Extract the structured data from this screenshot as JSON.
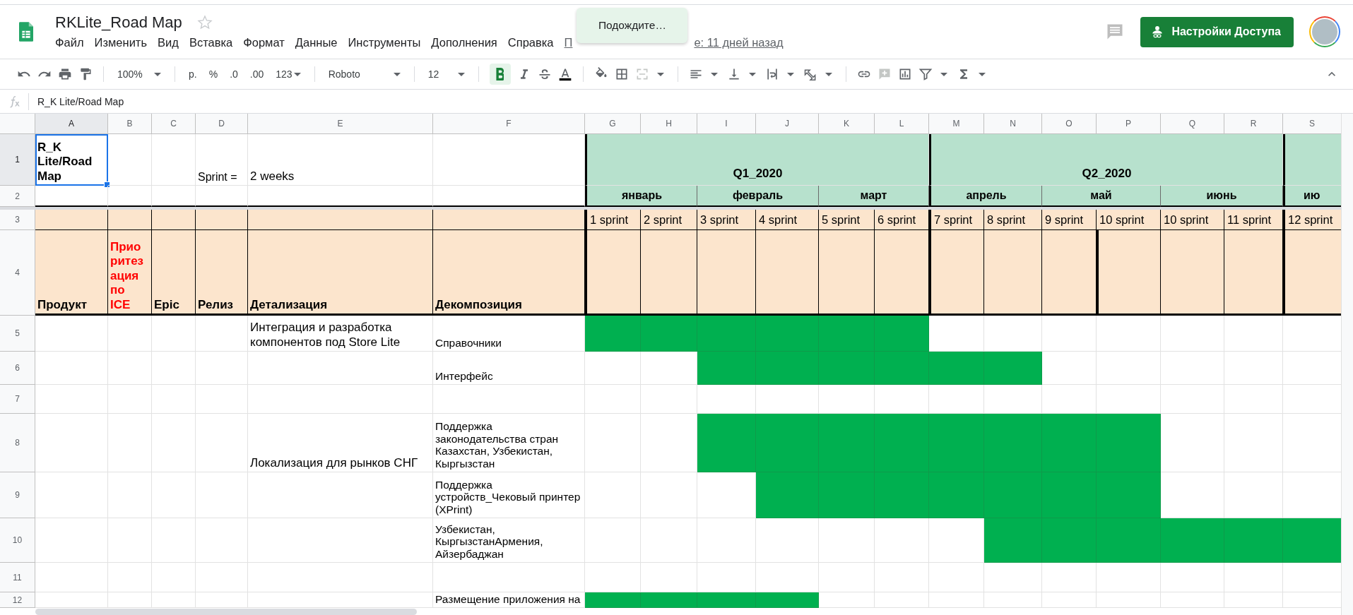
{
  "header": {
    "title": "RKLite_Road Map",
    "menu": [
      "Файл",
      "Изменить",
      "Вид",
      "Вставка",
      "Формат",
      "Данные",
      "Инструменты",
      "Дополнения",
      "Справка"
    ],
    "last_edit_start": "П",
    "last_edit_end": "е: 11 дней назад",
    "toast": "Подождите…",
    "share_button": "Настройки Доступа"
  },
  "toolbar": {
    "zoom": "100%",
    "currency": "р.",
    "percent": "%",
    "decimal_decrease": ".0",
    "decimal_increase": ".00",
    "number_format": "123",
    "font": "Roboto",
    "font_size": "12",
    "bold_selected": true
  },
  "formula_bar": {
    "value": "R_K Lite/Road Map"
  },
  "columns": [
    {
      "label": "A",
      "selected": true
    },
    {
      "label": "B",
      "selected": false
    },
    {
      "label": "C",
      "selected": false
    },
    {
      "label": "D",
      "selected": false
    },
    {
      "label": "E",
      "selected": false
    },
    {
      "label": "F",
      "selected": false
    },
    {
      "label": "G",
      "selected": false
    },
    {
      "label": "H",
      "selected": false
    },
    {
      "label": "I",
      "selected": false
    },
    {
      "label": "J",
      "selected": false
    },
    {
      "label": "K",
      "selected": false
    },
    {
      "label": "L",
      "selected": false
    },
    {
      "label": "M",
      "selected": false
    },
    {
      "label": "N",
      "selected": false
    },
    {
      "label": "O",
      "selected": false
    },
    {
      "label": "P",
      "selected": false
    },
    {
      "label": "Q",
      "selected": false
    },
    {
      "label": "R",
      "selected": false
    },
    {
      "label": "S",
      "selected": false
    }
  ],
  "title_rows": {
    "row_1": {
      "number": "1",
      "selected": true
    },
    "row_2": {
      "number": "2",
      "selected": false
    },
    "row_3": {
      "number": "3",
      "selected": false
    },
    "row_4": {
      "number": "4",
      "selected": false
    }
  },
  "title_cell": {
    "text": "R_K Lite/Road Map",
    "selected": true
  },
  "sprint_label": "Sprint =",
  "sprint_length": "2 weeks",
  "quarters": [
    "Q1_2020",
    "Q2_2020"
  ],
  "months": [
    "январь",
    "февраль",
    "март",
    "апрель",
    "май",
    "июнь",
    "ию"
  ],
  "sprints": [
    "1 sprint",
    "2 sprint",
    "3 sprint",
    "4 sprint",
    "5 sprint",
    "6 sprint",
    "7 sprint",
    "8 sprint",
    "9 sprint",
    "10 sprint",
    "10 sprint",
    "11 sprint",
    "12 sprint"
  ],
  "headers": [
    {
      "label": "Продукт",
      "color": "#000000"
    },
    {
      "label": "Приоритезация по ICE",
      "color": "#ff0000"
    },
    {
      "label": "Epic",
      "color": "#000000"
    },
    {
      "label": "Релиз",
      "color": "#000000"
    },
    {
      "label": "Детализация",
      "color": "#000000"
    },
    {
      "label": "Декомпозиция",
      "color": "#000000"
    }
  ],
  "rows": [
    {
      "number": "5",
      "selected": false,
      "detail": "Интеграция и разработка компонентов под Store Lite",
      "decomposition": "Справочники",
      "gantt": [
        true,
        true,
        true,
        true,
        true,
        true,
        false,
        false,
        false,
        false,
        false,
        false,
        false
      ]
    },
    {
      "number": "6",
      "selected": false,
      "decomposition": "Интерфейс",
      "gantt": [
        false,
        false,
        true,
        true,
        true,
        true,
        true,
        true,
        false,
        false,
        false,
        false,
        false
      ]
    },
    {
      "number": "7",
      "selected": false,
      "gantt": [
        false,
        false,
        false,
        false,
        false,
        false,
        false,
        false,
        false,
        false,
        false,
        false,
        false
      ]
    },
    {
      "number": "8",
      "selected": false,
      "detail": "Локализация для рынков СНГ",
      "decomposition": "Поддержка законодательства стран Казахстан, Узбекистан, Кыргызстан",
      "gantt": [
        false,
        false,
        true,
        true,
        true,
        true,
        true,
        true,
        true,
        true,
        false,
        false,
        false
      ]
    },
    {
      "number": "9",
      "selected": false,
      "decomposition": "Поддержка устройств_Чековый принтер (XPrint)",
      "gantt": [
        false,
        false,
        false,
        true,
        true,
        true,
        true,
        true,
        true,
        true,
        false,
        false,
        false
      ]
    },
    {
      "number": "10",
      "selected": false,
      "decomposition": "Узбекистан, КыргызстанАрмения, Айзербаджан",
      "gantt": [
        false,
        false,
        false,
        false,
        false,
        false,
        false,
        true,
        true,
        true,
        true,
        true,
        true
      ]
    },
    {
      "number": "11",
      "selected": false,
      "gantt": [
        false,
        false,
        false,
        false,
        false,
        false,
        false,
        false,
        false,
        false,
        false,
        false,
        false
      ]
    },
    {
      "number": "12",
      "selected": false,
      "decomposition": "Размещение приложения на",
      "gantt": [
        true,
        true,
        true,
        true,
        false,
        false,
        false,
        false,
        false,
        false,
        false,
        false,
        false
      ]
    }
  ]
}
